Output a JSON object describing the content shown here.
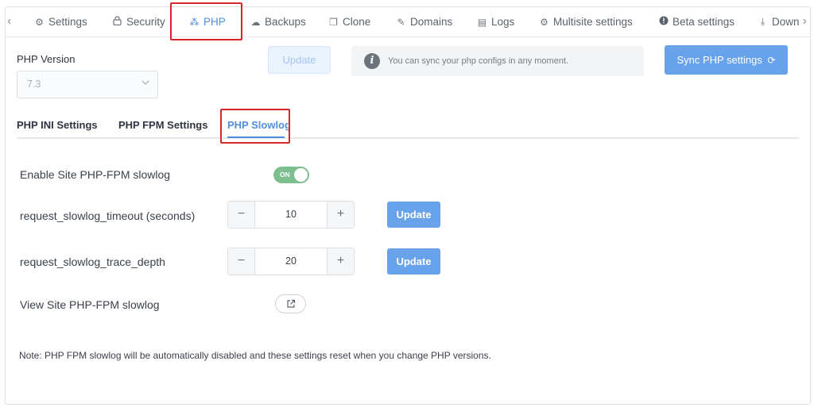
{
  "colors": {
    "accent": "#4f8fdb",
    "primary_button": "#68a2ea",
    "toggle_on": "#7dbf8e",
    "highlight_box": "#d9262c"
  },
  "tabs": [
    {
      "label": "Settings",
      "icon": "gear-icon"
    },
    {
      "label": "Security",
      "icon": "lock-icon"
    },
    {
      "label": "PHP",
      "icon": "spinner-icon",
      "active": true
    },
    {
      "label": "Backups",
      "icon": "cloud-upload-icon"
    },
    {
      "label": "Clone",
      "icon": "copy-icon"
    },
    {
      "label": "Domains",
      "icon": "edit-icon"
    },
    {
      "label": "Logs",
      "icon": "file-icon"
    },
    {
      "label": "Multisite settings",
      "icon": "gear-icon"
    },
    {
      "label": "Beta settings",
      "icon": "exclamation-circle-icon"
    },
    {
      "label": "Down",
      "icon": "download-icon"
    }
  ],
  "php_version": {
    "label": "PHP Version",
    "selected": "7.3",
    "update_label": "Update"
  },
  "info": {
    "icon": "info-icon",
    "text": "You can sync your php configs in any moment."
  },
  "sync_button": {
    "label": "Sync PHP settings",
    "icon": "refresh-icon"
  },
  "subtabs": [
    {
      "label": "PHP INI Settings"
    },
    {
      "label": "PHP FPM Settings"
    },
    {
      "label": "PHP Slowlog",
      "active": true
    }
  ],
  "slowlog": {
    "enable_label": "Enable Site PHP-FPM slowlog",
    "toggle_state": "ON",
    "timeout_label": "request_slowlog_timeout (seconds)",
    "timeout_value": "10",
    "trace_label": "request_slowlog_trace_depth",
    "trace_value": "20",
    "update_label": "Update",
    "minus": "−",
    "plus": "+",
    "view_label": "View Site PHP-FPM slowlog",
    "note": "Note: PHP FPM slowlog will be automatically disabled and these settings reset when you change PHP versions."
  }
}
